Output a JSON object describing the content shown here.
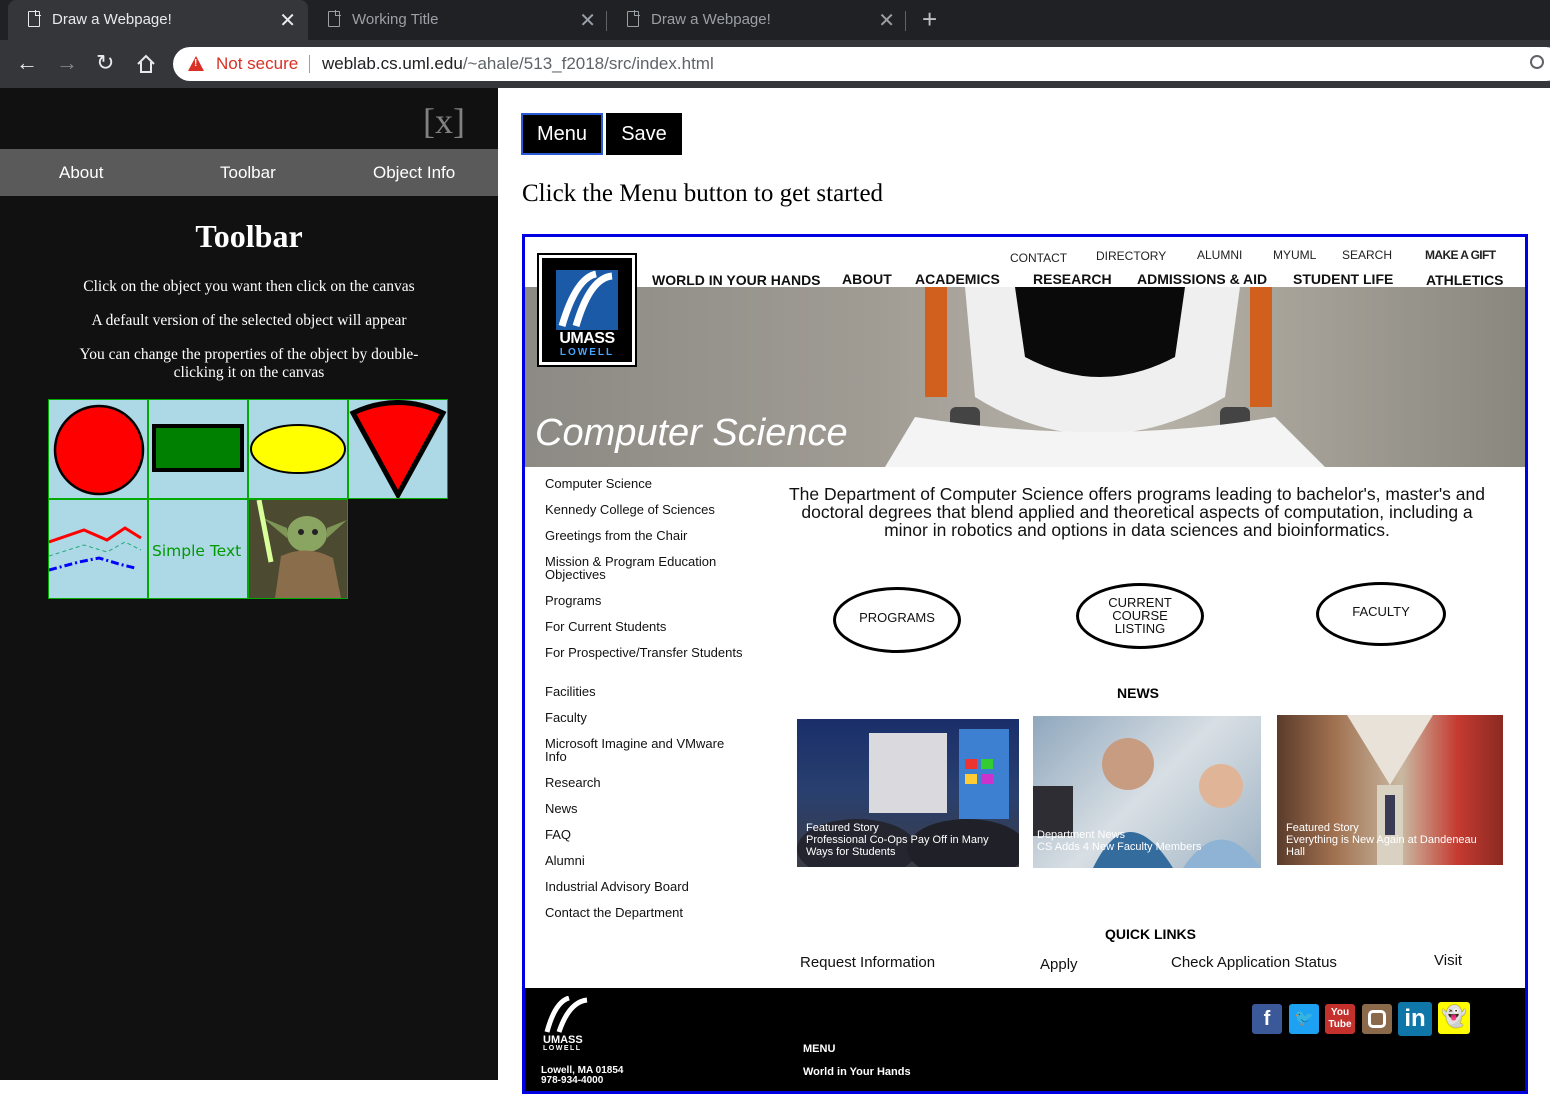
{
  "browser": {
    "tabs": [
      {
        "title": "Draw a Webpage!"
      },
      {
        "title": "Working Title"
      },
      {
        "title": "Draw a Webpage!"
      }
    ],
    "security": "Not secure",
    "url_host": "weblab.cs.uml.edu",
    "url_path": "/~ahale/513_f2018/src/index.html"
  },
  "sidebar": {
    "close": "[x]",
    "nav": [
      "About",
      "Toolbar",
      "Object Info"
    ],
    "title": "Toolbar",
    "instructions": [
      "Click on the object you want then click on the canvas",
      "A default version of the selected object will appear",
      "You can change the properties of the object by double-clicking it on the canvas"
    ],
    "tools": [
      "circle",
      "rectangle",
      "ellipse",
      "pie-slice",
      "polyline",
      "text",
      "image"
    ],
    "simple_text": "Simple Text"
  },
  "main": {
    "menu_button": "Menu",
    "save_button": "Save",
    "prompt": "Click the Menu button to get started"
  },
  "site": {
    "logo": {
      "line1": "UMASS",
      "line2": "LOWELL"
    },
    "top_links": [
      "CONTACT",
      "DIRECTORY",
      "ALUMNI",
      "MYUML",
      "SEARCH",
      "MAKE A GIFT"
    ],
    "main_nav": [
      "WORLD IN YOUR HANDS",
      "ABOUT",
      "ACADEMICS",
      "RESEARCH",
      "ADMISSIONS & AID",
      "STUDENT LIFE",
      "ATHLETICS"
    ],
    "hero_title": "Computer Science",
    "side_links": [
      "Computer Science",
      "Kennedy College of Sciences",
      "Greetings from the Chair",
      "Mission & Program Education Objectives",
      "Programs",
      "For Current Students",
      "For Prospective/Transfer Students",
      "Facilities",
      "Faculty",
      "Microsoft Imagine and VMware Info",
      "Research",
      "News",
      "FAQ",
      "Alumni",
      "Industrial Advisory Board",
      "Contact the Department"
    ],
    "intro": "The Department of Computer Science offers programs leading to bachelor's, master's and doctoral degrees that blend applied and theoretical aspects of computation, including a minor in robotics and options in data sciences and bioinformatics.",
    "ovals": [
      "PROGRAMS",
      "CURRENT COURSE LISTING",
      "FACULTY"
    ],
    "news_heading": "NEWS",
    "news": [
      {
        "caption": "Featured Story\nProfessional Co-Ops Pay Off in Many Ways for Students"
      },
      {
        "caption": "Department News\nCS Adds 4 New Faculty Members"
      },
      {
        "caption": "Featured Story\nEverything is New Again at Dandeneau Hall"
      }
    ],
    "quick_links_heading": "QUICK LINKS",
    "quick_links": [
      "Request Information",
      "Apply",
      "Check Application Status",
      "Visit"
    ],
    "footer": {
      "menu": "MENU",
      "menu_item": "World in Your Hands",
      "address": "Lowell, MA 01854",
      "phone": "978-934-4000"
    },
    "social": [
      "facebook",
      "twitter",
      "youtube",
      "instagram",
      "linkedin",
      "snapchat"
    ]
  }
}
